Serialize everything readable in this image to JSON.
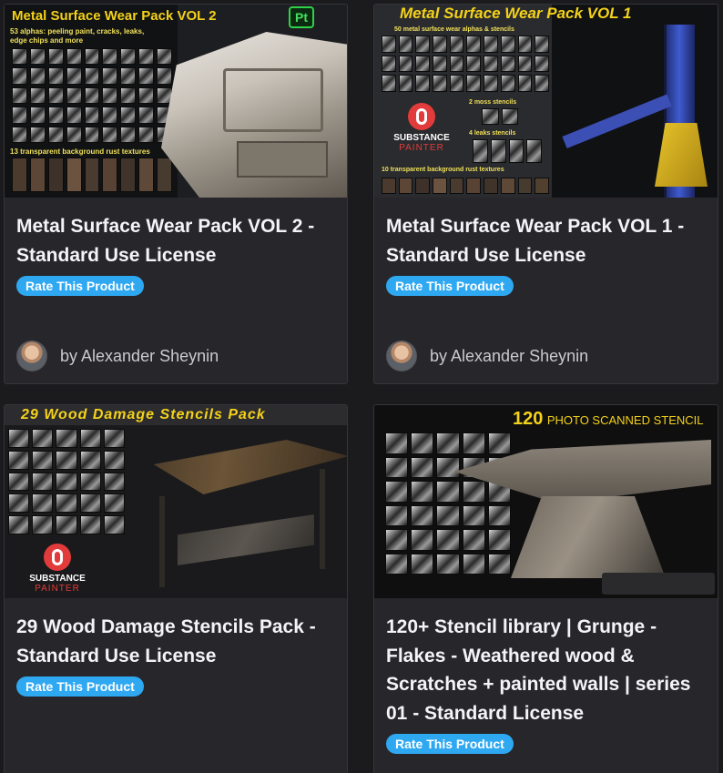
{
  "products": [
    {
      "title": "Metal Surface Wear Pack VOL 2 - Standard Use License",
      "rate_label": "Rate This Product",
      "author": "by Alexander Sheynin",
      "thumb": {
        "heading": "Metal Surface Wear Pack VOL 2",
        "badge": "Pt",
        "line1": "53 alphas: peeling paint, cracks, leaks,",
        "line2": "edge chips and more",
        "line3": "13 transparent background rust textures"
      }
    },
    {
      "title": "Metal Surface Wear Pack VOL 1 - Standard Use License",
      "rate_label": "Rate This Product",
      "author": "by Alexander Sheynin",
      "thumb": {
        "heading": "Metal Surface Wear Pack VOL 1",
        "line1": "50 metal surface wear alphas & stencils",
        "line2": "2 moss stencils",
        "line3": "4 leaks stencils",
        "line4": "10 transparent background rust textures",
        "logo_top": "SUBSTANCE",
        "logo_bottom": "PAINTER"
      }
    },
    {
      "title": "29 Wood Damage Stencils Pack - Standard Use License",
      "rate_label": "Rate This Product",
      "thumb": {
        "heading": "29 Wood Damage Stencils Pack",
        "logo_top": "SUBSTANCE",
        "logo_bottom": "PAINTER"
      }
    },
    {
      "title": "120+ Stencil library | Grunge - Flakes - Weathered wood & Scratches + painted walls | series 01 - Standard License",
      "rate_label": "Rate This Product",
      "thumb": {
        "heading_num": "120",
        "heading_rest": "PHOTO SCANNED STENCIL"
      }
    }
  ],
  "colors": {
    "page_bg": "#1b1b1e",
    "card_bg": "#27272b",
    "badge_bg": "#2fa8f2",
    "thumb_title_yellow": "#f4d21a"
  }
}
